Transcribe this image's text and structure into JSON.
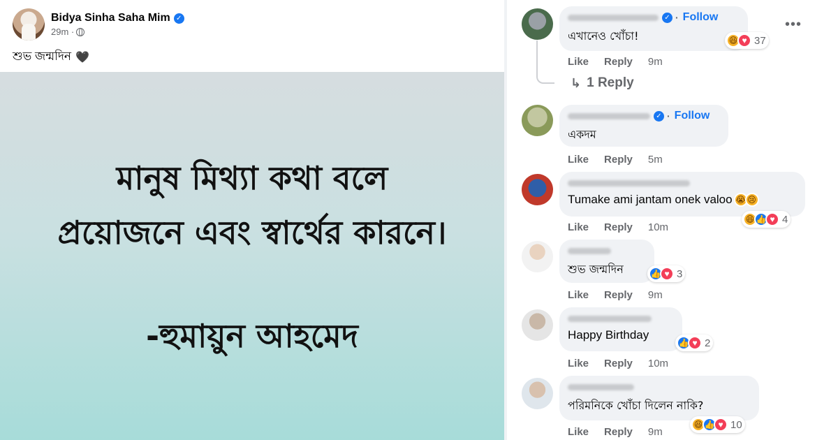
{
  "post": {
    "author": "Bidya Sinha Saha Mim",
    "time": "29m",
    "text": "শুভ জন্মদিন",
    "quote_lines": [
      "মানুষ মিথ্যা কথা বলে",
      "প্রয়োজনে এবং স্বার্থের কারনে।",
      "-হুমায়ুন আহমেদ"
    ]
  },
  "labels": {
    "like": "Like",
    "reply": "Reply",
    "follow": "Follow",
    "more": "•••"
  },
  "comments": [
    {
      "text": "এখানেও খোঁচা!",
      "time": "9m",
      "reaction_count": "37",
      "reply_count": "1 Reply",
      "follow": true
    },
    {
      "text": "একদম",
      "time": "5m",
      "follow": true
    },
    {
      "text": "Tumake ami jantam onek valoo",
      "time": "10m",
      "reaction_count": "4"
    },
    {
      "text": "শুভ জন্মদিন",
      "time": "9m",
      "reaction_count": "3"
    },
    {
      "text": "Happy Birthday",
      "time": "10m",
      "reaction_count": "2"
    },
    {
      "text": "পরিমনিকে খোঁচা দিলেন নাকি?",
      "time": "9m",
      "reaction_count": "10"
    }
  ],
  "colors": {
    "link": "#1877f2",
    "muted": "#65676b",
    "bubble": "#f0f2f5"
  }
}
